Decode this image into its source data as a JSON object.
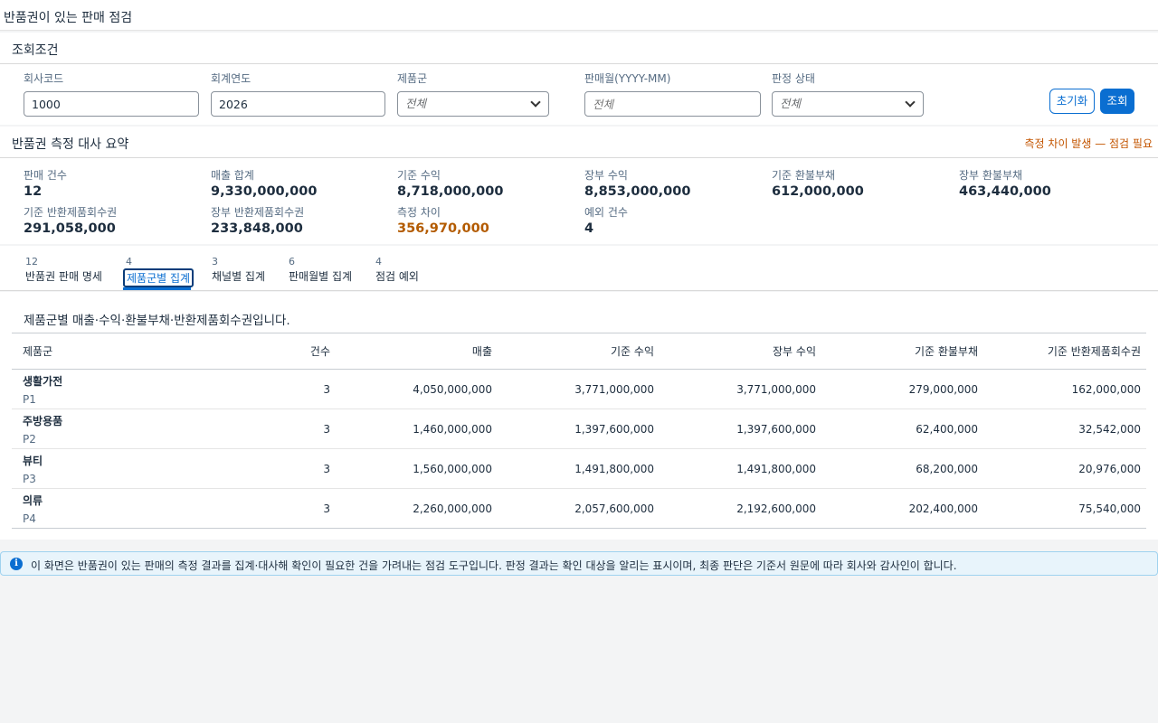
{
  "page": {
    "title": "반품권이 있는 판매 점검"
  },
  "filter": {
    "title": "조회조건",
    "company_code": {
      "label": "회사코드",
      "value": "1000"
    },
    "fiscal_year": {
      "label": "회계연도",
      "value": "2026"
    },
    "product_group": {
      "label": "제품군",
      "placeholder": "전체"
    },
    "sales_month": {
      "label": "판매월(YYYY-MM)",
      "placeholder": "전체"
    },
    "judgement_status": {
      "label": "판정 상태",
      "placeholder": "전체"
    },
    "reset_label": "초기화",
    "search_label": "조회"
  },
  "summary": {
    "title": "반품권 측정 대사 요약",
    "warning": "측정 차이 발생 — 점검 필요",
    "metrics": [
      {
        "label": "판매 건수",
        "value": "12"
      },
      {
        "label": "매출 합계",
        "value": "9,330,000,000"
      },
      {
        "label": "기준 수익",
        "value": "8,718,000,000"
      },
      {
        "label": "장부 수익",
        "value": "8,853,000,000"
      },
      {
        "label": "기준 환불부채",
        "value": "612,000,000"
      },
      {
        "label": "장부 환불부채",
        "value": "463,440,000"
      },
      {
        "label": "기준 반환제품회수권",
        "value": "291,058,000"
      },
      {
        "label": "장부 반환제품회수권",
        "value": "233,848,000"
      },
      {
        "label": "측정 차이",
        "value": "356,970,000"
      },
      {
        "label": "예외 건수",
        "value": "4"
      }
    ]
  },
  "tabs": [
    {
      "count": "12",
      "label": "반품권 판매 명세"
    },
    {
      "count": "4",
      "label": "제품군별 집계"
    },
    {
      "count": "3",
      "label": "채널별 집계"
    },
    {
      "count": "6",
      "label": "판매월별 집계"
    },
    {
      "count": "4",
      "label": "점검 예외"
    }
  ],
  "table": {
    "caption": "제품군별 매출·수익·환불부채·반환제품회수권입니다.",
    "columns": [
      "제품군",
      "건수",
      "매출",
      "기준 수익",
      "장부 수익",
      "기준 환불부채",
      "기준 반환제품회수권"
    ],
    "rows": [
      {
        "name": "생활가전",
        "code": "P1",
        "count": "3",
        "sales": "4,050,000,000",
        "std_revenue": "3,771,000,000",
        "book_revenue": "3,771,000,000",
        "refund_liability": "279,000,000",
        "return_asset": "162,000,000"
      },
      {
        "name": "주방용품",
        "code": "P2",
        "count": "3",
        "sales": "1,460,000,000",
        "std_revenue": "1,397,600,000",
        "book_revenue": "1,397,600,000",
        "refund_liability": "62,400,000",
        "return_asset": "32,542,000"
      },
      {
        "name": "뷰티",
        "code": "P3",
        "count": "3",
        "sales": "1,560,000,000",
        "std_revenue": "1,491,800,000",
        "book_revenue": "1,491,800,000",
        "refund_liability": "68,200,000",
        "return_asset": "20,976,000"
      },
      {
        "name": "의류",
        "code": "P4",
        "count": "3",
        "sales": "2,260,000,000",
        "std_revenue": "2,057,600,000",
        "book_revenue": "2,192,600,000",
        "refund_liability": "202,400,000",
        "return_asset": "75,540,000"
      }
    ]
  },
  "info": {
    "icon": "info-icon",
    "text": "이 화면은 반품권이 있는 판매의 측정 결과를 집계·대사해 확인이 필요한 건을 가려내는 점검 도구입니다. 판정 결과는 확인 대상을 알리는 표시이며, 최종 판단은 기준서 원문에 따라 회사와 감사인이 합니다."
  },
  "colors": {
    "accent": "#0a6ed1",
    "warning": "#c35500"
  }
}
